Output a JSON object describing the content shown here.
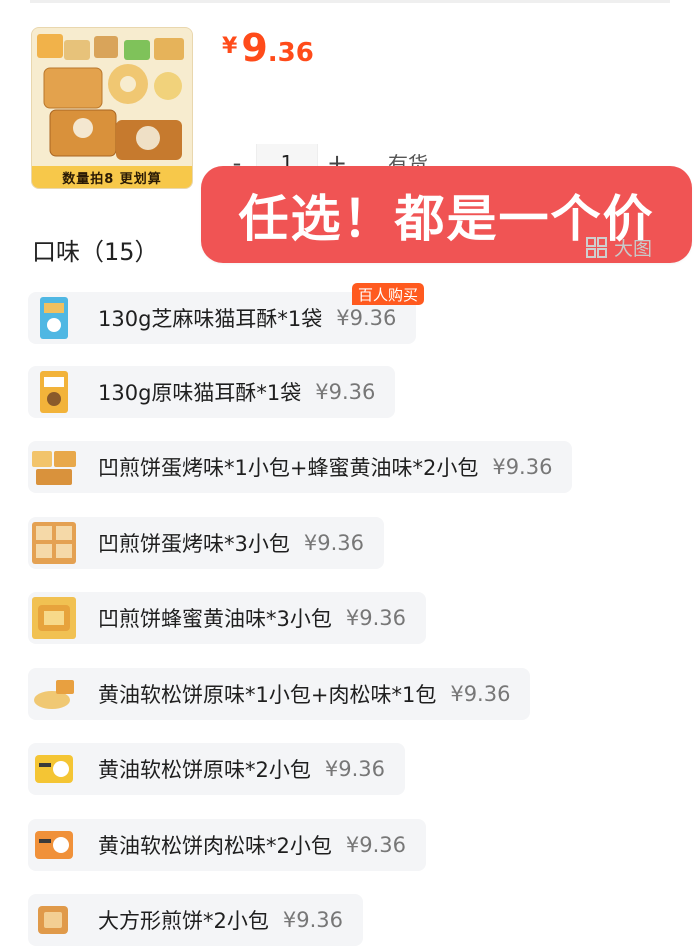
{
  "product": {
    "thumb_caption": "数量拍8 更划算",
    "price_symbol": "¥",
    "price_int": "9",
    "price_dec": ".36"
  },
  "quantity": {
    "minus": "-",
    "value": "1",
    "plus": "+",
    "stock": "有货"
  },
  "banner": {
    "text": "任选！都是一个价"
  },
  "big_image_label": "大图",
  "section": {
    "title": "口味（15）"
  },
  "badge": "百人购买",
  "options": [
    {
      "label": "130g芝麻味猫耳酥*1袋",
      "price": "¥9.36"
    },
    {
      "label": "130g原味猫耳酥*1袋",
      "price": "¥9.36"
    },
    {
      "label": "凹煎饼蛋烤味*1小包+蜂蜜黄油味*2小包",
      "price": "¥9.36"
    },
    {
      "label": "凹煎饼蛋烤味*3小包",
      "price": "¥9.36"
    },
    {
      "label": "凹煎饼蜂蜜黄油味*3小包",
      "price": "¥9.36"
    },
    {
      "label": "黄油软松饼原味*1小包+肉松味*1包",
      "price": "¥9.36"
    },
    {
      "label": "黄油软松饼原味*2小包",
      "price": "¥9.36"
    },
    {
      "label": "黄油软松饼肉松味*2小包",
      "price": "¥9.36"
    },
    {
      "label": "大方形煎饼*2小包",
      "price": "¥9.36"
    }
  ]
}
